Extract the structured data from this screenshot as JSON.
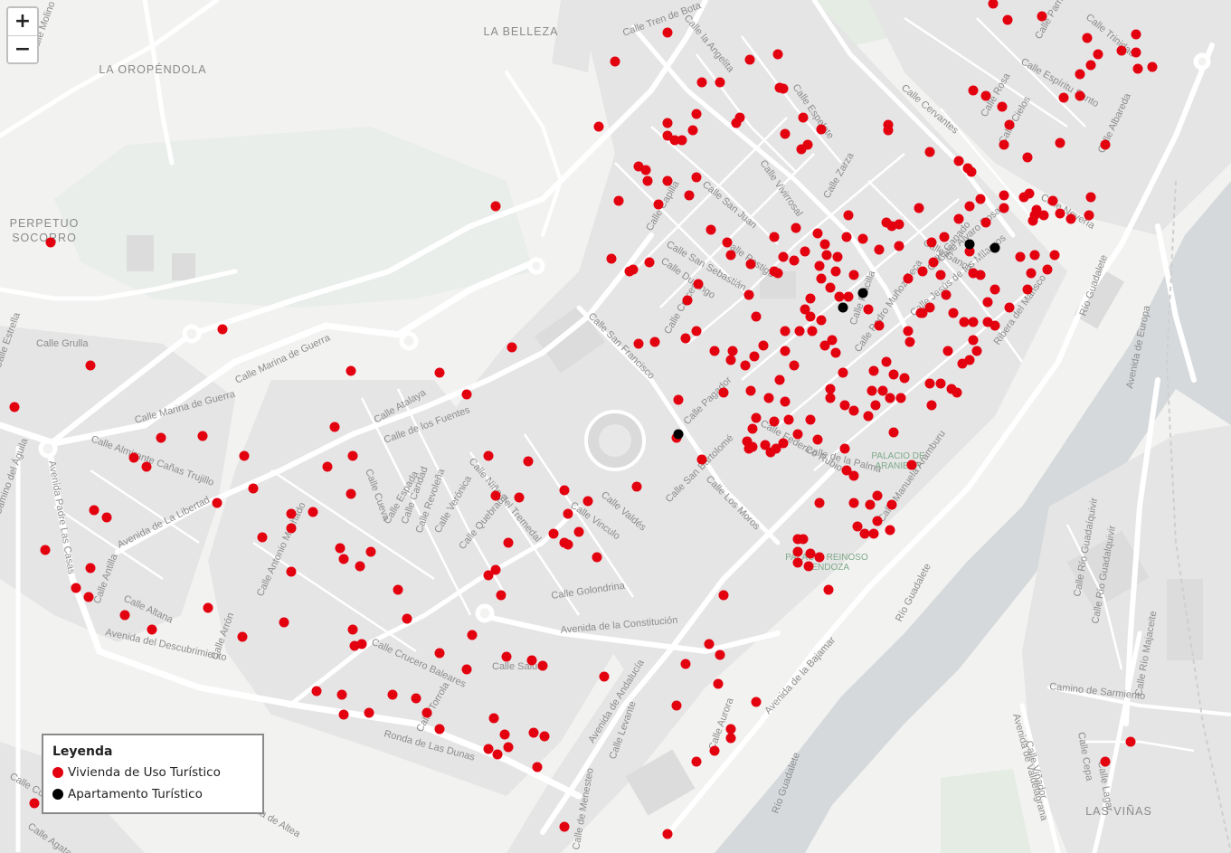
{
  "zoom": {
    "in_label": "+",
    "out_label": "−"
  },
  "legend": {
    "title": "Leyenda",
    "items": [
      {
        "label": "Vivienda de Uso Turístico",
        "color": "#e3000f"
      },
      {
        "label": "Apartamento Turístico",
        "color": "#000000"
      }
    ]
  },
  "map_labels": {
    "places": [
      "LA BELLEZA",
      "LA OROPÉNDOLA",
      "PERPETUO",
      "SOCORRO",
      "LAS VIÑAS"
    ],
    "landmarks": [
      "PALACIO DE",
      "ARANIBAR",
      "PALACIO REINOSO",
      "MENDOZA"
    ],
    "streets": [
      "Avenida de La Libertad",
      "Avenida del Descubrimiento",
      "Avenida Padre Las Casas",
      "Calle Crucero Baleares",
      "Ronda de Las Dunas",
      "Avenida de la Constitución",
      "Avenida de Andalucía",
      "Avenida de la Bajamar",
      "Calle Valdés",
      "Calle San Francisco",
      "Calle Los Moros",
      "Calle Cruces",
      "Calle San Juan",
      "Calle Cervantes",
      "Ribera del Marisco",
      "Avenida de Europa",
      "Avenida de Valdelagrana",
      "Camino de Sarmiento",
      "Río Guadalete",
      "Calle Marina de Guerra",
      "Calle Almirante Cañas Trujillo",
      "Calle Golondrina",
      "Calle Aurora",
      "Calle Pagador",
      "Calle Pedro Muñoz Seca",
      "Calle Ganado",
      "Calle Placilla",
      "Calle Zarza",
      "Calle Manuela Aramburu",
      "Calle de la Palma",
      "Calle Grulla",
      "Calle Atalaya",
      "Calle de los Fuentes",
      "Calle Federico Rubio",
      "Calle San Bartolomé",
      "Calle Postigo",
      "Calle Durango",
      "Calle San Sebastián",
      "Calle Capilla",
      "Calle Nevería",
      "Calle Cielos",
      "Calle Rosa",
      "Calle Espíritu Santo",
      "Calle Parra",
      "Calle Albareda",
      "Calle Trinidad",
      "Calle Lagar",
      "Calle Cepa",
      "Calle Viñador",
      "Calle Tren de Bota",
      "Calle la Angelita",
      "Calle Espelete",
      "Calle Quebrado",
      "Calle Villa de Altea",
      "Calle Agata",
      "Calle Arrón",
      "Calle Altana",
      "Calle Vinculo",
      "Calle Niño del Tremedal",
      "Calle Verónica",
      "Calle Revoleña",
      "Calle Caridad",
      "Calle Espada",
      "Calle Cueva",
      "Calle Antonio Machado",
      "Calle Alvaro Rosa",
      "Calle Salud",
      "Calle Ganchos",
      "Camino del Águila",
      "Calle Molino Plata",
      "Calle Levante",
      "Calle Torrola",
      "Calle de Menesteo",
      "Calle Jesús de los Milagros",
      "Calle Río Guadaíquivir",
      "Calle Río Majaceite",
      "Calle Río Guadalquivir",
      "Calle Vivirrosal",
      "Calle Estrella",
      "Calle Cuna",
      "Calle Antilla"
    ]
  },
  "vut_points": [
    [
      738,
      36
    ],
    [
      680,
      68
    ],
    [
      662,
      140
    ],
    [
      776,
      91
    ],
    [
      796,
      91
    ],
    [
      829,
      66
    ],
    [
      860,
      60
    ],
    [
      862,
      97
    ],
    [
      866,
      98
    ],
    [
      888,
      130
    ],
    [
      908,
      143
    ],
    [
      893,
      160
    ],
    [
      868,
      148
    ],
    [
      886,
      165
    ],
    [
      818,
      130
    ],
    [
      814,
      136
    ],
    [
      770,
      126
    ],
    [
      766,
      144
    ],
    [
      738,
      136
    ],
    [
      738,
      150
    ],
    [
      746,
      155
    ],
    [
      754,
      155
    ],
    [
      706,
      184
    ],
    [
      714,
      188
    ],
    [
      716,
      200
    ],
    [
      738,
      200
    ],
    [
      770,
      196
    ],
    [
      762,
      216
    ],
    [
      684,
      222
    ],
    [
      728,
      226
    ],
    [
      786,
      254
    ],
    [
      804,
      268
    ],
    [
      808,
      282
    ],
    [
      830,
      292
    ],
    [
      828,
      326
    ],
    [
      836,
      350
    ],
    [
      856,
      262
    ],
    [
      880,
      252
    ],
    [
      904,
      258
    ],
    [
      878,
      288
    ],
    [
      866,
      284
    ],
    [
      860,
      302
    ],
    [
      912,
      270
    ],
    [
      914,
      282
    ],
    [
      926,
      284
    ],
    [
      938,
      238
    ],
    [
      936,
      262
    ],
    [
      954,
      264
    ],
    [
      972,
      276
    ],
    [
      994,
      272
    ],
    [
      986,
      250
    ],
    [
      980,
      246
    ],
    [
      994,
      248
    ],
    [
      1016,
      230
    ],
    [
      1030,
      268
    ],
    [
      1044,
      262
    ],
    [
      1032,
      290
    ],
    [
      1020,
      300
    ],
    [
      1004,
      308
    ],
    [
      1040,
      304
    ],
    [
      1046,
      326
    ],
    [
      1028,
      340
    ],
    [
      1020,
      346
    ],
    [
      1054,
      346
    ],
    [
      1072,
      278
    ],
    [
      1076,
      302
    ],
    [
      1084,
      304
    ],
    [
      1060,
      242
    ],
    [
      1084,
      220
    ],
    [
      1072,
      228
    ],
    [
      1090,
      246
    ],
    [
      1110,
      216
    ],
    [
      1110,
      230
    ],
    [
      1132,
      218
    ],
    [
      1138,
      214
    ],
    [
      1146,
      232
    ],
    [
      1154,
      238
    ],
    [
      1144,
      238
    ],
    [
      1142,
      244
    ],
    [
      1164,
      222
    ],
    [
      1172,
      236
    ],
    [
      1184,
      242
    ],
    [
      1206,
      218
    ],
    [
      1204,
      238
    ],
    [
      1166,
      282
    ],
    [
      1144,
      282
    ],
    [
      1128,
      284
    ],
    [
      1158,
      298
    ],
    [
      1140,
      302
    ],
    [
      1136,
      320
    ],
    [
      1116,
      340
    ],
    [
      1100,
      320
    ],
    [
      1092,
      334
    ],
    [
      1092,
      356
    ],
    [
      1100,
      360
    ],
    [
      1066,
      356
    ],
    [
      1076,
      356
    ],
    [
      1076,
      376
    ],
    [
      1080,
      388
    ],
    [
      1072,
      398
    ],
    [
      1064,
      402
    ],
    [
      1048,
      388
    ],
    [
      1040,
      424
    ],
    [
      1052,
      430
    ],
    [
      1058,
      434
    ],
    [
      1030,
      448
    ],
    [
      1028,
      424
    ],
    [
      1000,
      418
    ],
    [
      996,
      440
    ],
    [
      984,
      440
    ],
    [
      976,
      432
    ],
    [
      964,
      432
    ],
    [
      966,
      410
    ],
    [
      980,
      400
    ],
    [
      988,
      414
    ],
    [
      968,
      448
    ],
    [
      960,
      460
    ],
    [
      944,
      454
    ],
    [
      934,
      448
    ],
    [
      918,
      440
    ],
    [
      918,
      430
    ],
    [
      932,
      412
    ],
    [
      924,
      390
    ],
    [
      920,
      376
    ],
    [
      912,
      382
    ],
    [
      908,
      354
    ],
    [
      896,
      350
    ],
    [
      890,
      342
    ],
    [
      896,
      330
    ],
    [
      908,
      308
    ],
    [
      918,
      318
    ],
    [
      928,
      328
    ],
    [
      938,
      328
    ],
    [
      944,
      304
    ],
    [
      924,
      300
    ],
    [
      906,
      294
    ],
    [
      890,
      278
    ],
    [
      960,
      342
    ],
    [
      972,
      360
    ],
    [
      1004,
      366
    ],
    [
      1006,
      378
    ],
    [
      1018,
      346
    ],
    [
      898,
      366
    ],
    [
      884,
      366
    ],
    [
      868,
      366
    ],
    [
      868,
      388
    ],
    [
      878,
      404
    ],
    [
      844,
      382
    ],
    [
      834,
      394
    ],
    [
      824,
      404
    ],
    [
      830,
      432
    ],
    [
      850,
      440
    ],
    [
      868,
      444
    ],
    [
      862,
      420
    ],
    [
      800,
      434
    ],
    [
      808,
      398
    ],
    [
      810,
      388
    ],
    [
      790,
      388
    ],
    [
      770,
      366
    ],
    [
      758,
      374
    ],
    [
      724,
      378
    ],
    [
      706,
      380
    ],
    [
      760,
      332
    ],
    [
      772,
      314
    ],
    [
      718,
      290
    ],
    [
      700,
      298
    ],
    [
      676,
      286
    ],
    [
      696,
      300
    ],
    [
      856,
      466
    ],
    [
      872,
      464
    ],
    [
      896,
      464
    ],
    [
      882,
      480
    ],
    [
      904,
      486
    ],
    [
      836,
      462
    ],
    [
      832,
      474
    ],
    [
      826,
      488
    ],
    [
      832,
      494
    ],
    [
      846,
      492
    ],
    [
      858,
      496
    ],
    [
      866,
      490
    ],
    [
      852,
      500
    ],
    [
      828,
      496
    ],
    [
      906,
      556
    ],
    [
      936,
      520
    ],
    [
      944,
      526
    ],
    [
      944,
      556
    ],
    [
      962,
      558
    ],
    [
      970,
      548
    ],
    [
      986,
      558
    ],
    [
      970,
      576
    ],
    [
      948,
      582
    ],
    [
      956,
      590
    ],
    [
      966,
      590
    ],
    [
      984,
      586
    ],
    [
      1008,
      514
    ],
    [
      988,
      478
    ],
    [
      934,
      496
    ],
    [
      882,
      596
    ],
    [
      888,
      596
    ],
    [
      882,
      610
    ],
    [
      896,
      612
    ],
    [
      882,
      622
    ],
    [
      894,
      626
    ],
    [
      906,
      616
    ],
    [
      916,
      652
    ],
    [
      856,
      300
    ],
    [
      750,
      442
    ],
    [
      748,
      484
    ],
    [
      776,
      508
    ],
    [
      800,
      658
    ],
    [
      704,
      538
    ],
    [
      758,
      734
    ],
    [
      784,
      712
    ],
    [
      796,
      724
    ],
    [
      794,
      756
    ],
    [
      748,
      780
    ],
    [
      770,
      842
    ],
    [
      790,
      830
    ],
    [
      808,
      806
    ],
    [
      808,
      816
    ],
    [
      836,
      776
    ],
    [
      738,
      922
    ],
    [
      624,
      914
    ],
    [
      668,
      748
    ],
    [
      660,
      616
    ],
    [
      650,
      554
    ],
    [
      624,
      542
    ],
    [
      628,
      568
    ],
    [
      624,
      600
    ],
    [
      612,
      590
    ],
    [
      628,
      602
    ],
    [
      640,
      588
    ],
    [
      574,
      550
    ],
    [
      562,
      600
    ],
    [
      584,
      510
    ],
    [
      548,
      548
    ],
    [
      540,
      504
    ],
    [
      548,
      630
    ],
    [
      540,
      636
    ],
    [
      554,
      658
    ],
    [
      522,
      702
    ],
    [
      486,
      722
    ],
    [
      516,
      740
    ],
    [
      560,
      726
    ],
    [
      588,
      730
    ],
    [
      600,
      736
    ],
    [
      546,
      794
    ],
    [
      558,
      812
    ],
    [
      562,
      826
    ],
    [
      590,
      810
    ],
    [
      602,
      814
    ],
    [
      540,
      828
    ],
    [
      550,
      834
    ],
    [
      594,
      848
    ],
    [
      486,
      806
    ],
    [
      472,
      788
    ],
    [
      460,
      772
    ],
    [
      434,
      768
    ],
    [
      408,
      788
    ],
    [
      380,
      790
    ],
    [
      378,
      768
    ],
    [
      350,
      764
    ],
    [
      390,
      696
    ],
    [
      392,
      714
    ],
    [
      400,
      712
    ],
    [
      450,
      684
    ],
    [
      440,
      652
    ],
    [
      410,
      610
    ],
    [
      398,
      626
    ],
    [
      380,
      618
    ],
    [
      376,
      606
    ],
    [
      346,
      566
    ],
    [
      322,
      568
    ],
    [
      322,
      584
    ],
    [
      290,
      594
    ],
    [
      322,
      632
    ],
    [
      314,
      688
    ],
    [
      268,
      704
    ],
    [
      230,
      672
    ],
    [
      168,
      696
    ],
    [
      138,
      680
    ],
    [
      98,
      660
    ],
    [
      84,
      650
    ],
    [
      100,
      628
    ],
    [
      118,
      572
    ],
    [
      104,
      564
    ],
    [
      50,
      608
    ],
    [
      148,
      506
    ],
    [
      162,
      516
    ],
    [
      178,
      484
    ],
    [
      224,
      482
    ],
    [
      270,
      504
    ],
    [
      280,
      540
    ],
    [
      240,
      556
    ],
    [
      362,
      516
    ],
    [
      390,
      504
    ],
    [
      388,
      546
    ],
    [
      370,
      472
    ],
    [
      388,
      410
    ],
    [
      486,
      412
    ],
    [
      516,
      436
    ],
    [
      566,
      384
    ],
    [
      246,
      364
    ],
    [
      100,
      404
    ],
    [
      16,
      450
    ],
    [
      56,
      268
    ],
    [
      548,
      228
    ],
    [
      38,
      888
    ],
    [
      1222,
      842
    ],
    [
      1250,
      820
    ],
    [
      1028,
      168
    ],
    [
      1060,
      178
    ],
    [
      1070,
      186
    ],
    [
      1074,
      190
    ],
    [
      1108,
      118
    ],
    [
      1110,
      160
    ],
    [
      1116,
      138
    ],
    [
      1136,
      174
    ],
    [
      1172,
      158
    ],
    [
      1076,
      100
    ],
    [
      1090,
      106
    ],
    [
      1222,
      160
    ],
    [
      1176,
      108
    ],
    [
      1194,
      106
    ],
    [
      1194,
      82
    ],
    [
      1206,
      72
    ],
    [
      1214,
      60
    ],
    [
      1202,
      42
    ],
    [
      1240,
      56
    ],
    [
      1256,
      38
    ],
    [
      1256,
      58
    ],
    [
      1258,
      76
    ],
    [
      1274,
      74
    ],
    [
      1114,
      22
    ],
    [
      1152,
      18
    ],
    [
      1098,
      4
    ],
    [
      982,
      138
    ],
    [
      982,
      144
    ]
  ],
  "apt_points": [
    [
      1072,
      270
    ],
    [
      1100,
      274
    ],
    [
      954,
      324
    ],
    [
      932,
      340
    ],
    [
      750,
      480
    ]
  ]
}
